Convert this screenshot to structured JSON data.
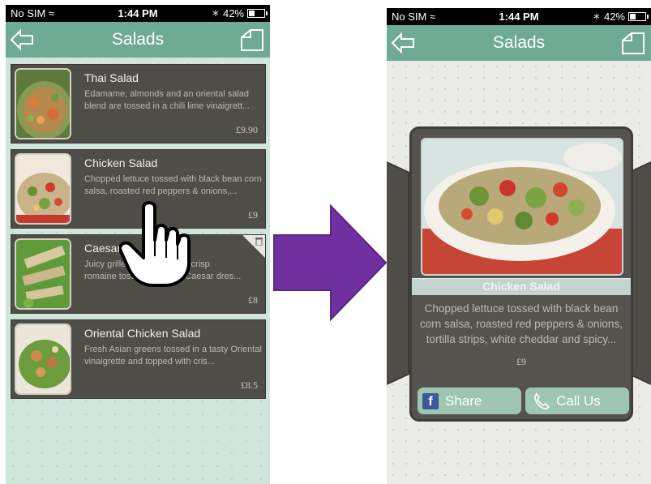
{
  "status_bar": {
    "carrier": "No SIM",
    "time": "1:44 PM",
    "battery": "42%"
  },
  "nav": {
    "title": "Salads"
  },
  "menu_items": [
    {
      "name": "Thai Salad",
      "desc": "Edamame, almonds and an oriental salad blend are tossed in a chili lime vinaigrett...",
      "price": "£9.90"
    },
    {
      "name": "Chicken Salad",
      "desc": "Chopped lettuce tossed with black bean corn salsa, roasted red peppers & onions,...",
      "price": "£9"
    },
    {
      "name": "Caesar",
      "desc_line1": "Juicy grilled",
      "desc_line1b": "st over crisp",
      "desc_line2": "romaine toss",
      "desc_line2b": "arlic Caesar dres...",
      "price": "£8"
    },
    {
      "name": "Oriental Chicken Salad",
      "desc": "Fresh Asian greens tossed in a tasty Oriental vinaigrette and topped with cris...",
      "price": "£8.5"
    }
  ],
  "detail": {
    "title": "Chicken Salad",
    "desc": "Chopped lettuce tossed with black bean corn salsa, roasted red peppers & onions, tortilla strips, white cheddar and spicy...",
    "price": "£9",
    "share_label": "Share",
    "call_label": "Call Us"
  },
  "colors": {
    "accent": "#6faa95",
    "card": "#4f4d48",
    "arrow": "#7030a0",
    "button": "#9ec6b3"
  }
}
